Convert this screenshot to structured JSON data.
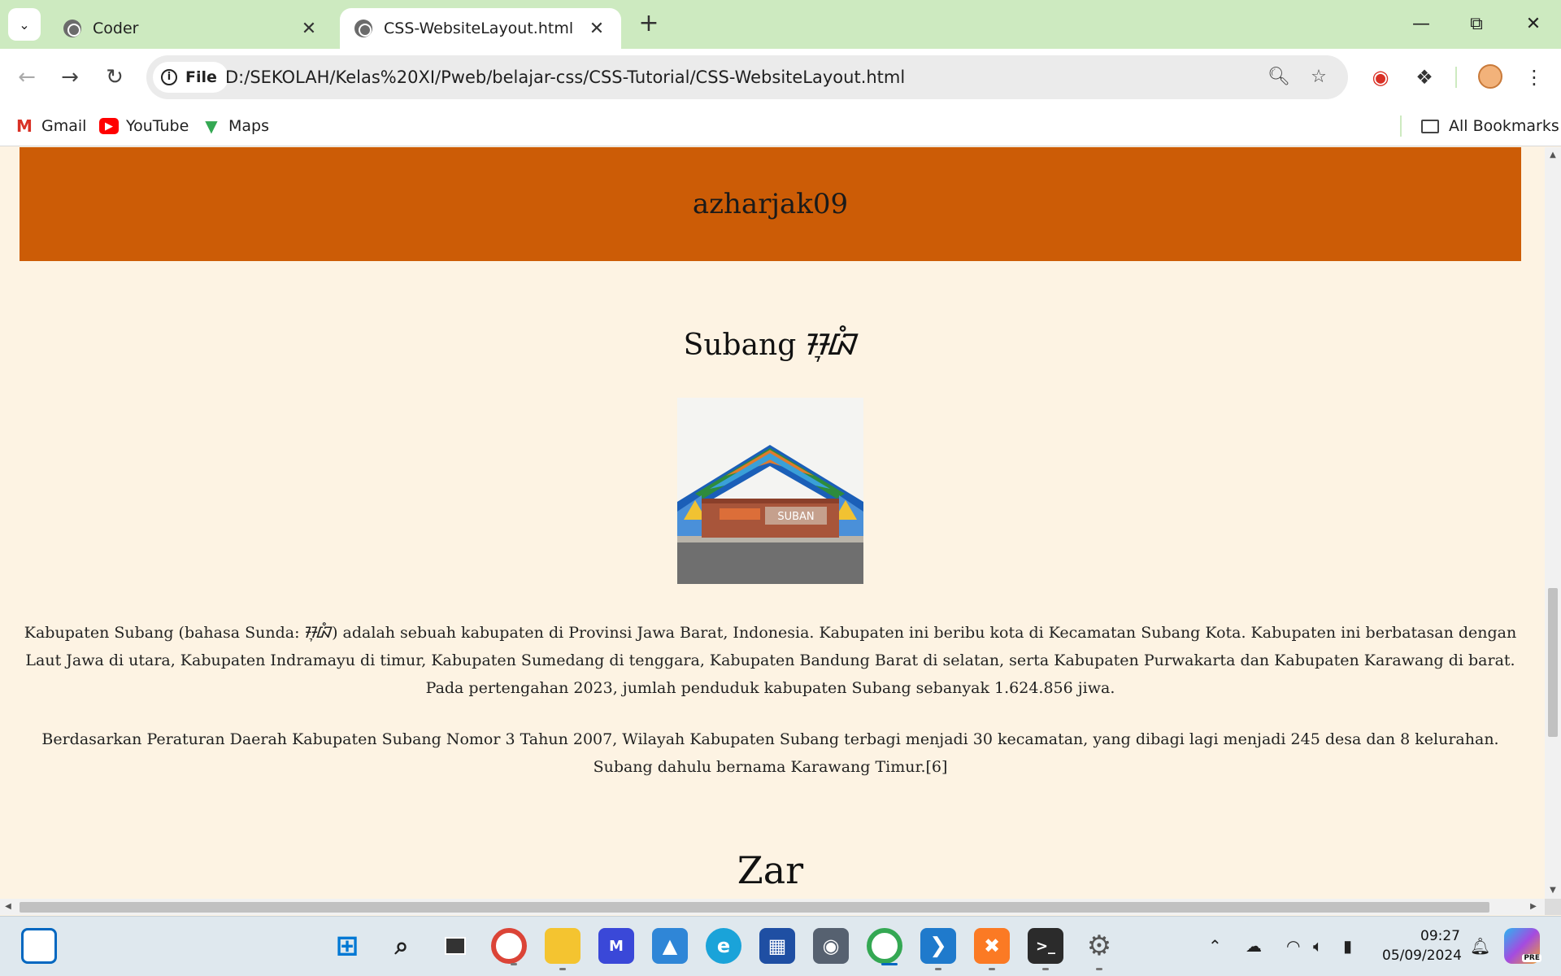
{
  "browser": {
    "tabs": [
      {
        "label": "Coder",
        "active": false
      },
      {
        "label": "CSS-WebsiteLayout.html",
        "active": true
      }
    ],
    "address": {
      "chip_label": "File",
      "url": "D:/SEKOLAH/Kelas%20XI/Pweb/belajar-css/CSS-Tutorial/CSS-WebsiteLayout.html"
    },
    "bookmarks": [
      {
        "label": "Gmail",
        "icon": "gmail-icon"
      },
      {
        "label": "YouTube",
        "icon": "youtube-icon"
      },
      {
        "label": "Maps",
        "icon": "maps-icon"
      }
    ],
    "all_bookmarks_label": "All Bookmarks"
  },
  "page": {
    "banner_text": "azharjak09",
    "heading": "Subang ᮞᮥᮘᮀ",
    "image_alt": "Subang city gate photo",
    "image_sign_text": "SUBAN",
    "paragraphs": [
      "Kabupaten Subang (bahasa Sunda: ᮞᮥᮘᮀ) adalah sebuah kabupaten di Provinsi Jawa Barat, Indonesia. Kabupaten ini beribu kota di Kecamatan Subang Kota. Kabupaten ini berbatasan dengan Laut Jawa di utara, Kabupaten Indramayu di timur, Kabupaten Sumedang di tenggara, Kabupaten Bandung Barat di selatan, serta Kabupaten Purwakarta dan Kabupaten Karawang di barat. Pada pertengahan 2023, jumlah penduduk kabupaten Subang sebanyak 1.624.856 jiwa.",
      "Berdasarkan Peraturan Daerah Kabupaten Subang Nomor 3 Tahun 2007, Wilayah Kabupaten Subang terbagi menjadi 30 kecamatan, yang dibagi lagi menjadi 245 desa dan 8 kelurahan. Subang dahulu bernama Karawang Timur.[6]"
    ],
    "next_heading": "Zar",
    "banner_color": "#cc5c06",
    "background_color": "#fdf3e3"
  },
  "taskbar": {
    "time": "09:27",
    "date": "05/09/2024",
    "apps": [
      "windows-start-icon",
      "search-icon",
      "task-view-icon",
      "chrome-icon",
      "file-explorer-icon",
      "ai-app-icon",
      "photos-icon",
      "edge-icon",
      "store-icon",
      "camera-icon",
      "chrome-profile-icon",
      "vscode-icon",
      "xampp-icon",
      "terminal-icon",
      "settings-icon"
    ],
    "copilot_badge": "PRE"
  }
}
